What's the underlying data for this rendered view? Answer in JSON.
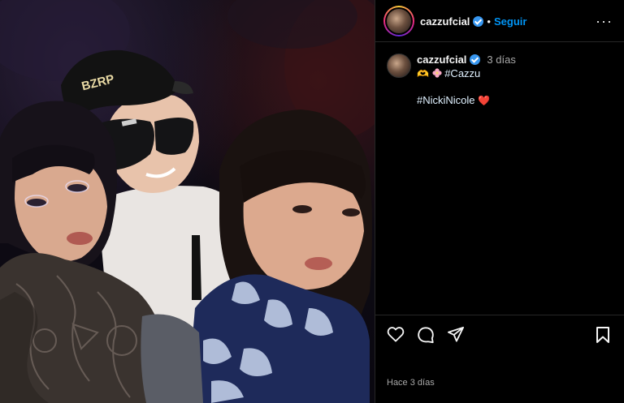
{
  "post": {
    "username": "cazzufcial",
    "verified": true,
    "follow_label": "Seguir",
    "separator": "•",
    "more_label": "···",
    "caption": {
      "author": "cazzufcial",
      "time_ago": "3 días",
      "line1_prefix": "🫶",
      "line1_tag": "#Cazzu",
      "line2_tag": "#NickiNicole",
      "heart": "❤️"
    },
    "footer_time": "Hace 3 días",
    "photo": {
      "cap_text": "BZRP"
    }
  },
  "colors": {
    "accent": "#0095f6",
    "verified": "#3897f0",
    "heart": "#e11d2b"
  },
  "icons": [
    "more-options-icon",
    "heart-icon",
    "comment-icon",
    "share-icon",
    "bookmark-icon",
    "verified-icon",
    "flower-emoji"
  ]
}
